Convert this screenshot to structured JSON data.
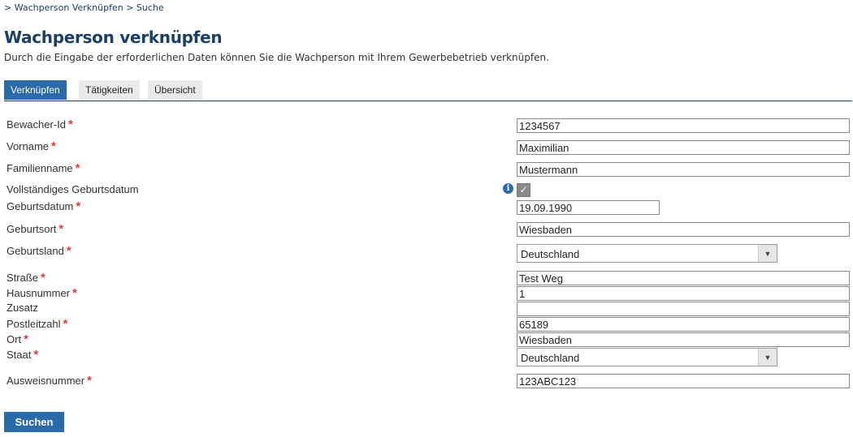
{
  "breadcrumb": "> Wachperson Verknüpfen > Suche",
  "title": "Wachperson verknüpfen",
  "intro": "Durch die Eingabe der erforderlichen Daten können Sie die Wachperson mit Ihrem Gewerbebetrieb verknüpfen.",
  "tabs": [
    "Verknüpfen",
    "Tätigkeiten",
    "Übersicht"
  ],
  "required_mark": "*",
  "info_icon": "i",
  "checkmark": "✓",
  "fields": {
    "bewacher_id": {
      "label": "Bewacher-Id",
      "value": "1234567"
    },
    "vorname": {
      "label": "Vorname",
      "value": "Maximilian"
    },
    "familienname": {
      "label": "Familienname",
      "value": "Mustermann"
    },
    "vollstaendiges_geburtsdatum": {
      "label": "Vollständiges Geburtsdatum",
      "checked": true
    },
    "geburtsdatum": {
      "label": "Geburtsdatum",
      "value": "19.09.1990"
    },
    "geburtsort": {
      "label": "Geburtsort",
      "value": "Wiesbaden"
    },
    "geburtsland": {
      "label": "Geburtsland",
      "value": "Deutschland"
    },
    "strasse": {
      "label": "Straße",
      "value": "Test Weg"
    },
    "hausnummer": {
      "label": "Hausnummer",
      "value": "1"
    },
    "zusatz": {
      "label": "Zusatz",
      "value": ""
    },
    "postleitzahl": {
      "label": "Postleitzahl",
      "value": "65189"
    },
    "ort": {
      "label": "Ort",
      "value": "Wiesbaden"
    },
    "staat": {
      "label": "Staat",
      "value": "Deutschland"
    },
    "ausweisnummer": {
      "label": "Ausweisnummer",
      "value": "123ABC123"
    }
  },
  "submit_label": "Suchen",
  "colors": {
    "accent": "#2b6aa8",
    "title": "#1b3f66",
    "required": "#e03b3b"
  }
}
